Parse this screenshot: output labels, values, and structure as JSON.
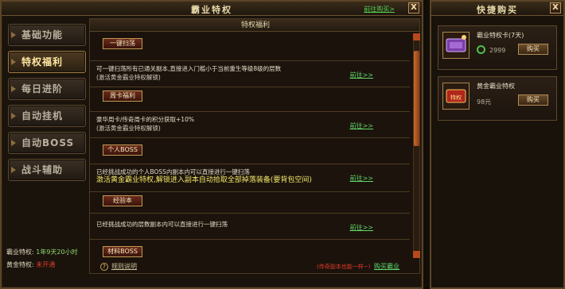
{
  "main_window": {
    "title": "霸业特权",
    "title_link": "前往购买>",
    "close": "X"
  },
  "tabs": [
    {
      "label": "基础功能"
    },
    {
      "label": "特权福利"
    },
    {
      "label": "每日进阶"
    },
    {
      "label": "自动挂机"
    },
    {
      "label": "自动BOSS"
    },
    {
      "label": "战斗辅助"
    }
  ],
  "side_info": {
    "line1_label": "霸业特权:",
    "line1_value": "1年9天20小时",
    "line2_label": "黄金特权:",
    "line2_value": "未开通"
  },
  "content": {
    "header": "特权福利",
    "sections": [
      {
        "tag": "一键扫荡",
        "desc": "可一键扫荡所有已通关副本,直接进入门槛小于当前重生等级8级的层数",
        "sub": "(激活黄金霸业特权解锁)",
        "go": "前往>>"
      },
      {
        "tag": "周卡福利",
        "desc": "豪华周卡/传奇周卡的积分获取+10%",
        "sub": "(激活黄金霸业特权解锁)",
        "go": "前往>>"
      },
      {
        "tag": "个人BOSS",
        "desc": "已经挑战成功的个人BOSS内副本内可以直接进行一键扫荡",
        "sub": "激活黄金霸业特权,解锁进入副本自动拾取全部掉落装备(要背包空间)",
        "go": "前往>>"
      },
      {
        "tag": "经验本",
        "desc": "已经挑战成功的层数副本内可以直接进行一键扫荡",
        "sub": "",
        "go": "前往>>"
      },
      {
        "tag": "材料BOSS",
        "desc": "",
        "sub": "",
        "go": ""
      }
    ]
  },
  "bottom": {
    "rule_text": "规则说明",
    "hint": "(传奇副本也能一样~)",
    "link": "购买霸业"
  },
  "quick_buy": {
    "title": "快捷购买",
    "close": "X",
    "items": [
      {
        "name": "霸业特权卡(7天)",
        "price": "2999",
        "buy": "购买",
        "icon": "privilege-card-icon"
      },
      {
        "name": "黄金霸业特权",
        "price": "98元",
        "buy": "购买",
        "icon": "gold-privilege-icon"
      }
    ]
  }
}
